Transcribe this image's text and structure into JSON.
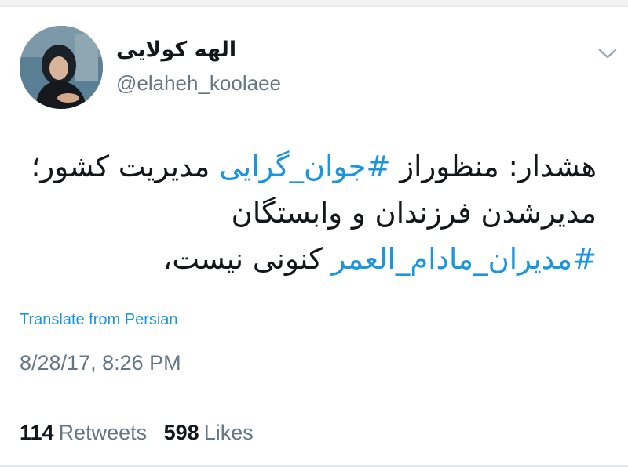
{
  "tweet": {
    "author": {
      "display_name": "الهه کولایی",
      "handle": "@elaheh_koolaee",
      "avatar_icon": "profile-photo"
    },
    "menu_icon": "chevron-down-icon",
    "body": {
      "line1_prefix": "هشدار: منظوراز ",
      "line1_hashtag": "#جوان_گرایی",
      "line1_suffix": " مدیریت کشور؛",
      "line2": "مدیرشدن فرزندان و وابستگان",
      "line3_hashtag": "#مدیران_مادام_العمر",
      "line3_suffix": " کنونی نیست،"
    },
    "translate_label": "Translate from Persian",
    "timestamp": "8/28/17, 8:26 PM",
    "stats": {
      "retweets_count": "114",
      "retweets_label": "Retweets",
      "likes_count": "598",
      "likes_label": "Likes"
    },
    "colors": {
      "link": "#1b95e0",
      "secondary_text": "#657786",
      "primary_text": "#14171a"
    }
  }
}
